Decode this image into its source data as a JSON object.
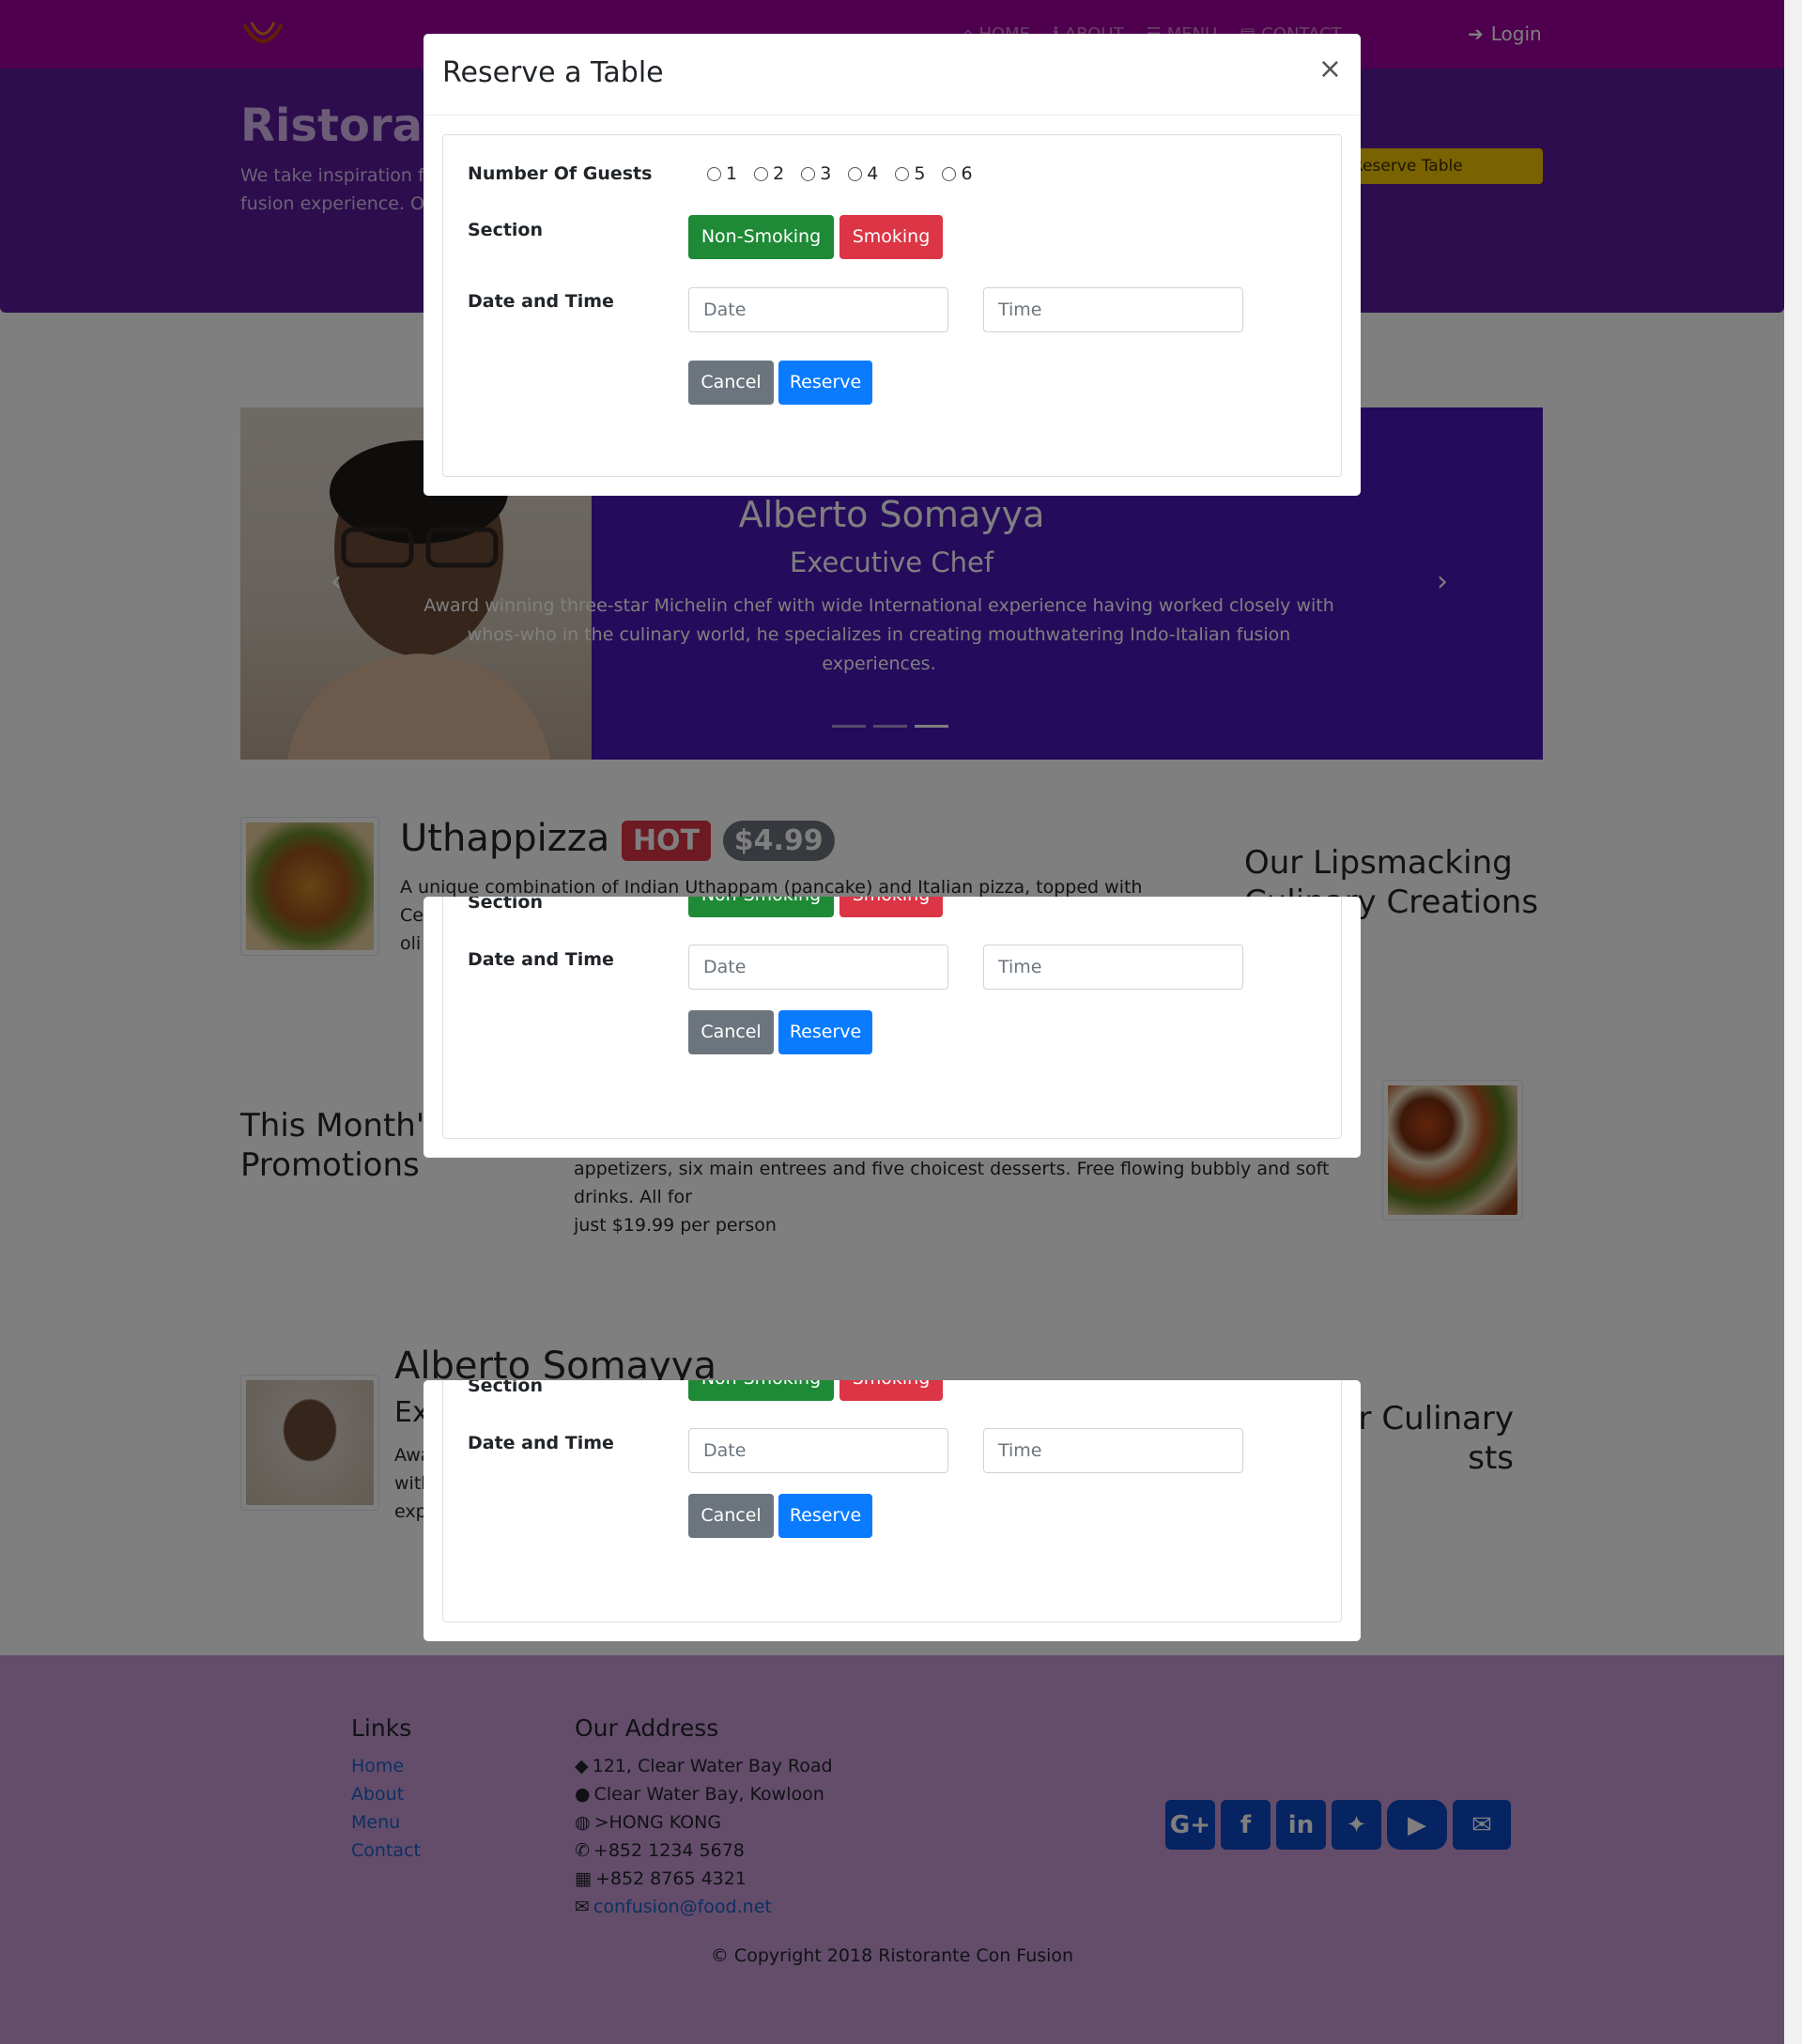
{
  "navbar": {
    "links": [
      {
        "label": "HOME",
        "icon": "home-icon"
      },
      {
        "label": "ABOUT",
        "icon": "info-icon"
      },
      {
        "label": "MENU",
        "icon": "list-icon"
      },
      {
        "label": "CONTACT",
        "icon": "address-card-icon"
      }
    ],
    "login_label": "Login"
  },
  "jumbotron": {
    "title": "Ristorante",
    "text_line1": "We take inspiration fr",
    "text_line2": "fusion experience. Our",
    "reserve_label": "Reserve Table"
  },
  "carousel": {
    "title": "Alberto Somayya",
    "subtitle": "Executive Chef",
    "text": "Award winning three-star Michelin chef with wide International experience having worked closely with whos-who in the culinary world, he specializes in creating mouthwatering Indo-Italian fusion experiences."
  },
  "dish": {
    "name": "Uthappizza",
    "badge": "HOT",
    "price": "$4.99",
    "description_line1": "A unique combination of Indian Uthappam (pancake) and Italian pizza, topped with Cerignola",
    "description_line2": "oli",
    "side_heading_line1": "Our Lipsmacking",
    "side_heading_line2": "Culinary Creations"
  },
  "promotion": {
    "heading_line1": "This Month's",
    "heading_line2": "Promotions",
    "description_line1": "appetizers, six main entrees and five choicest desserts. Free flowing bubbly and soft drinks. All for",
    "description_line2": "just $19.99 per person"
  },
  "leader": {
    "name": "Alberto Somayya",
    "designation_fragment": "Ex",
    "text_frag1": "Awa",
    "text_frag2": "with",
    "text_frag3": "exp",
    "side_heading_line1": "Our Culinary",
    "side_heading_line2": "sts"
  },
  "footer": {
    "links_heading": "Links",
    "links": [
      "Home",
      "About",
      "Menu",
      "Contact"
    ],
    "address_heading": "Our Address",
    "address": [
      "121, Clear Water Bay Road",
      "Clear Water Bay, Kowloon",
      ">HONG KONG"
    ],
    "phone": "+852 1234 5678",
    "fax": "+852 8765 4321",
    "email": "confusion@food.net",
    "copyright": "© Copyright 2018 Ristorante Con Fusion"
  },
  "modal": {
    "title": "Reserve a Table",
    "close": "×",
    "guests_label": "Number Of Guests",
    "guest_options": [
      "1",
      "2",
      "3",
      "4",
      "5",
      "6"
    ],
    "section_label": "Section",
    "non_smoking": "Non-Smoking",
    "smoking": "Smoking",
    "datetime_label": "Date and Time",
    "date_placeholder": "Date",
    "time_placeholder": "Time",
    "cancel": "Cancel",
    "reserve": "Reserve"
  },
  "colors": {
    "navbar": "#9c009c",
    "jumbotron": "#5a1b9b",
    "accent_yellow": "#f2c500",
    "success": "#1e8a36",
    "danger": "#dc3545",
    "primary": "#0a7bff"
  }
}
